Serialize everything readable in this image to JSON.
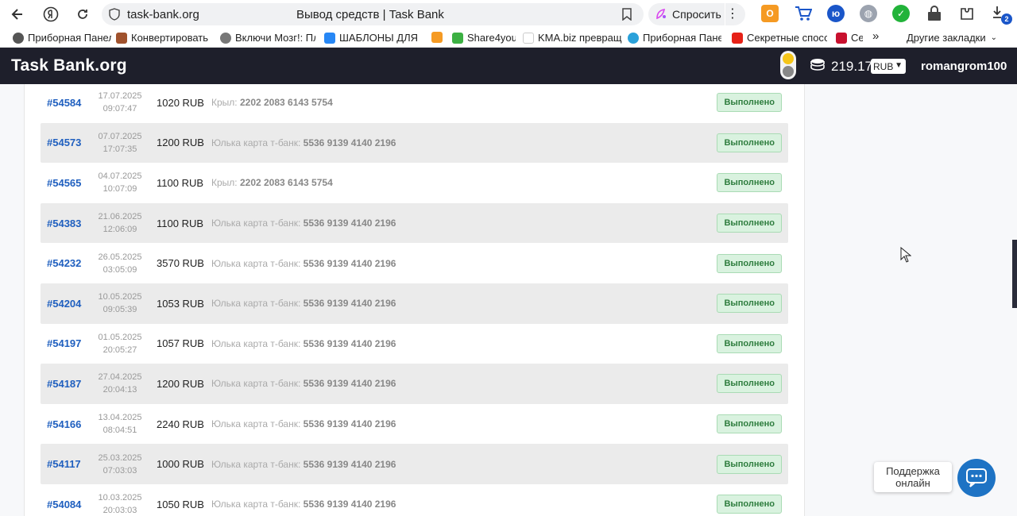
{
  "browser": {
    "url": "task-bank.org",
    "page_title": "Вывод средств | Task Bank",
    "ask_label": "Спросить",
    "downloads_badge": "2",
    "bookmarks": [
      "Приборная Панел",
      "Конвертировать I",
      "Включи Мозг!: Пл",
      "ШАБЛОНЫ ДЛЯ Р",
      "",
      "Share4you",
      "KMA.biz превращ",
      "Приборная Панел",
      "Секретные спосо",
      "Се"
    ],
    "more_bookmarks": "»",
    "other_bookmarks": "Другие закладки"
  },
  "site": {
    "logo": "Task Bank.org",
    "balance": "219.17",
    "currency": "RUB",
    "username": "romangrom100"
  },
  "withdrawals": [
    {
      "id": "#54584",
      "date": "17.07.2025",
      "time": "09:07:47",
      "amount": "1020 RUB",
      "dest_label": "Крыл:",
      "dest_card": "2202 2083 6143 5754",
      "status": "Выполнено"
    },
    {
      "id": "#54573",
      "date": "07.07.2025",
      "time": "17:07:35",
      "amount": "1200 RUB",
      "dest_label": "Юлька карта т-банк:",
      "dest_card": "5536 9139 4140 2196",
      "status": "Выполнено"
    },
    {
      "id": "#54565",
      "date": "04.07.2025",
      "time": "10:07:09",
      "amount": "1100 RUB",
      "dest_label": "Крыл:",
      "dest_card": "2202 2083 6143 5754",
      "status": "Выполнено"
    },
    {
      "id": "#54383",
      "date": "21.06.2025",
      "time": "12:06:09",
      "amount": "1100 RUB",
      "dest_label": "Юлька карта т-банк:",
      "dest_card": "5536 9139 4140 2196",
      "status": "Выполнено"
    },
    {
      "id": "#54232",
      "date": "26.05.2025",
      "time": "03:05:09",
      "amount": "3570 RUB",
      "dest_label": "Юлька карта т-банк:",
      "dest_card": "5536 9139 4140 2196",
      "status": "Выполнено"
    },
    {
      "id": "#54204",
      "date": "10.05.2025",
      "time": "09:05:39",
      "amount": "1053 RUB",
      "dest_label": "Юлька карта т-банк:",
      "dest_card": "5536 9139 4140 2196",
      "status": "Выполнено"
    },
    {
      "id": "#54197",
      "date": "01.05.2025",
      "time": "20:05:27",
      "amount": "1057 RUB",
      "dest_label": "Юлька карта т-банк:",
      "dest_card": "5536 9139 4140 2196",
      "status": "Выполнено"
    },
    {
      "id": "#54187",
      "date": "27.04.2025",
      "time": "20:04:13",
      "amount": "1200 RUB",
      "dest_label": "Юлька карта т-банк:",
      "dest_card": "5536 9139 4140 2196",
      "status": "Выполнено"
    },
    {
      "id": "#54166",
      "date": "13.04.2025",
      "time": "08:04:51",
      "amount": "2240 RUB",
      "dest_label": "Юлька карта т-банк:",
      "dest_card": "5536 9139 4140 2196",
      "status": "Выполнено"
    },
    {
      "id": "#54117",
      "date": "25.03.2025",
      "time": "07:03:03",
      "amount": "1000 RUB",
      "dest_label": "Юлька карта т-банк:",
      "dest_card": "5536 9139 4140 2196",
      "status": "Выполнено"
    },
    {
      "id": "#54084",
      "date": "10.03.2025",
      "time": "20:03:03",
      "amount": "1050 RUB",
      "dest_label": "Юлька карта т-банк:",
      "dest_card": "5536 9139 4140 2196",
      "status": "Выполнено"
    }
  ],
  "support": {
    "line1": "Поддержка",
    "line2": "онлайн"
  },
  "colors": {
    "header_bg": "#1e1f2b",
    "link_blue": "#1f5fbf",
    "status_green": "#2e7d3e",
    "chat_blue": "#1e73c4"
  }
}
